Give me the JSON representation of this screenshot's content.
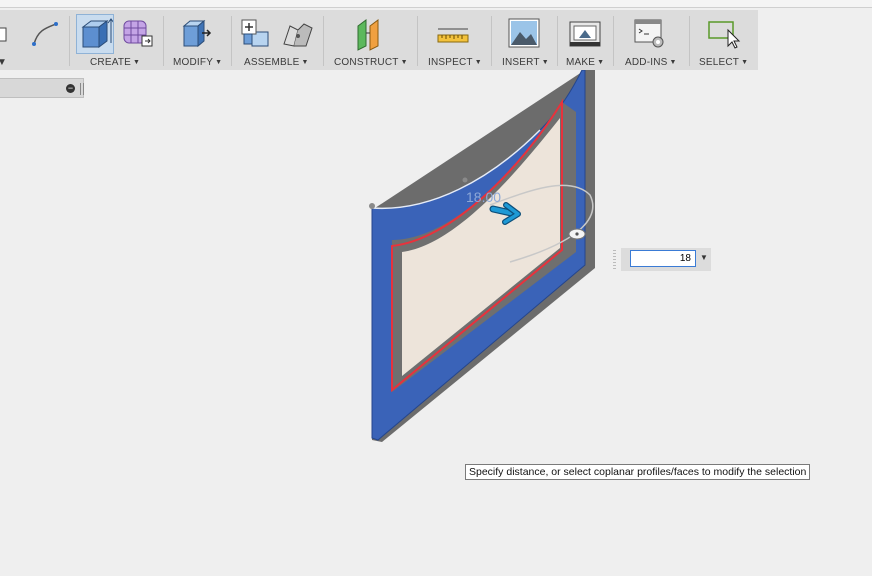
{
  "toolbar": {
    "groups": [
      {
        "label": "CREATE"
      },
      {
        "label": "MODIFY"
      },
      {
        "label": "ASSEMBLE"
      },
      {
        "label": "CONSTRUCT"
      },
      {
        "label": "INSPECT"
      },
      {
        "label": "INSERT"
      },
      {
        "label": "MAKE"
      },
      {
        "label": "ADD-INS"
      },
      {
        "label": "SELECT"
      }
    ],
    "caret": "▼"
  },
  "browser": {
    "collapse_symbol": "−"
  },
  "viewport": {
    "dimension_label": "18.00",
    "colors": {
      "body_blue": "#3a63b8",
      "profile_fill": "#ede4da",
      "selection_red": "#e8323c",
      "arrow_blue": "#1e9ad6"
    }
  },
  "distance_input": {
    "value": "18",
    "dropdown_symbol": "▼"
  },
  "tooltip": {
    "text": "Specify distance, or select coplanar profiles/faces to modify the selection"
  }
}
